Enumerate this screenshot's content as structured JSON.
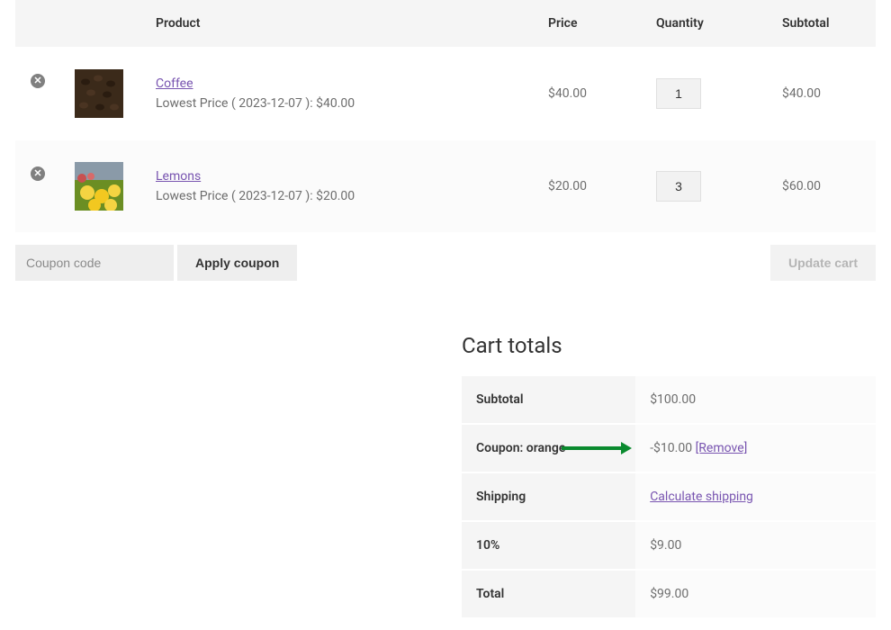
{
  "table": {
    "headers": {
      "product": "Product",
      "price": "Price",
      "quantity": "Quantity",
      "subtotal": "Subtotal"
    },
    "rows": [
      {
        "name": "Coffee",
        "lowest_price": "Lowest Price ( 2023-12-07 ): $40.00",
        "price": "$40.00",
        "qty": "1",
        "subtotal": "$40.00"
      },
      {
        "name": "Lemons",
        "lowest_price": "Lowest Price ( 2023-12-07 ): $20.00",
        "price": "$20.00",
        "qty": "3",
        "subtotal": "$60.00"
      }
    ]
  },
  "coupon": {
    "placeholder": "Coupon code",
    "apply_label": "Apply coupon",
    "update_label": "Update cart"
  },
  "totals": {
    "title": "Cart totals",
    "rows": {
      "subtotal_label": "Subtotal",
      "subtotal_value": "$100.00",
      "coupon_label": "Coupon: orange",
      "coupon_value": "-$10.00",
      "coupon_remove": "[Remove]",
      "shipping_label": "Shipping",
      "shipping_value": "Calculate shipping",
      "tax_label": "10%",
      "tax_value": "$9.00",
      "total_label": "Total",
      "total_value": "$99.00"
    }
  }
}
